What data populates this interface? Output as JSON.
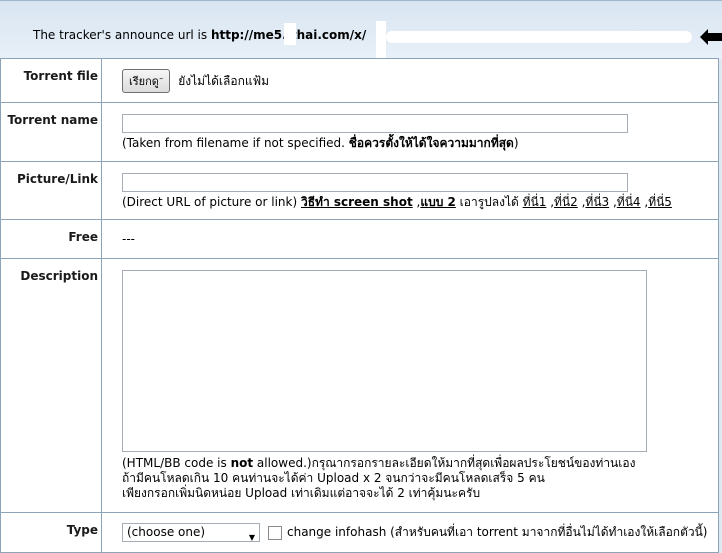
{
  "tracker": {
    "prefix": "The tracker's announce url is ",
    "url_visible": "http://me5.   thai.com/x/"
  },
  "form": {
    "torrent_file": {
      "label": "Torrent file",
      "button": "เรียกดู",
      "status": "ยังไม่ได้เลือกแฟ้ม"
    },
    "torrent_name": {
      "label": "Torrent name",
      "value": "",
      "hint_prefix": "(Taken from filename if not specified. ",
      "hint_bold": "ชื่อควรตั้งให้ได้ใจความมากที่สุด",
      "hint_suffix": ")"
    },
    "picture_link": {
      "label": "Picture/Link",
      "value": "",
      "hint_prefix": "(Direct URL of picture or link) ",
      "link_screenshot": "วิธีทำ screen shot",
      "sep1": " ,",
      "link_type2": "แบบ 2",
      "mid_text": " เอารูปลงได้ ",
      "link1": "ที่นี่1",
      "link2": "ที่นี่2",
      "link3": "ที่นี่3",
      "link4": "ที่นี่4",
      "link5": "ที่นี่5"
    },
    "free": {
      "label": "Free",
      "value": "---"
    },
    "description": {
      "label": "Description",
      "value": "",
      "note_prefix": "(HTML/BB code is ",
      "note_bold": "not",
      "note_rest1": " allowed.)กรุณากรอกรายละเอียดให้มากที่สุดเพื่อผลประโยชน์ของท่านเอง",
      "note_line2": "ถ้ามีคนโหลดเกิน 10 คนท่านจะได้ค่า Upload x 2 จนกว่าจะมีคนโหลดเสร็จ 5 คน",
      "note_line3": "เพียงกรอกเพิ่มนิดหน่อย Upload เท่าเดิมแต่อาจจะได้ 2 เท่าคุ้มนะครับ"
    },
    "type": {
      "label": "Type",
      "selected": "(choose one)",
      "checkbox_label": "change infohash (สำหรับคนที่เอา torrent มาจากที่อื่นไม่ได้ทำเองให้เลือกตัวนี้)"
    }
  }
}
